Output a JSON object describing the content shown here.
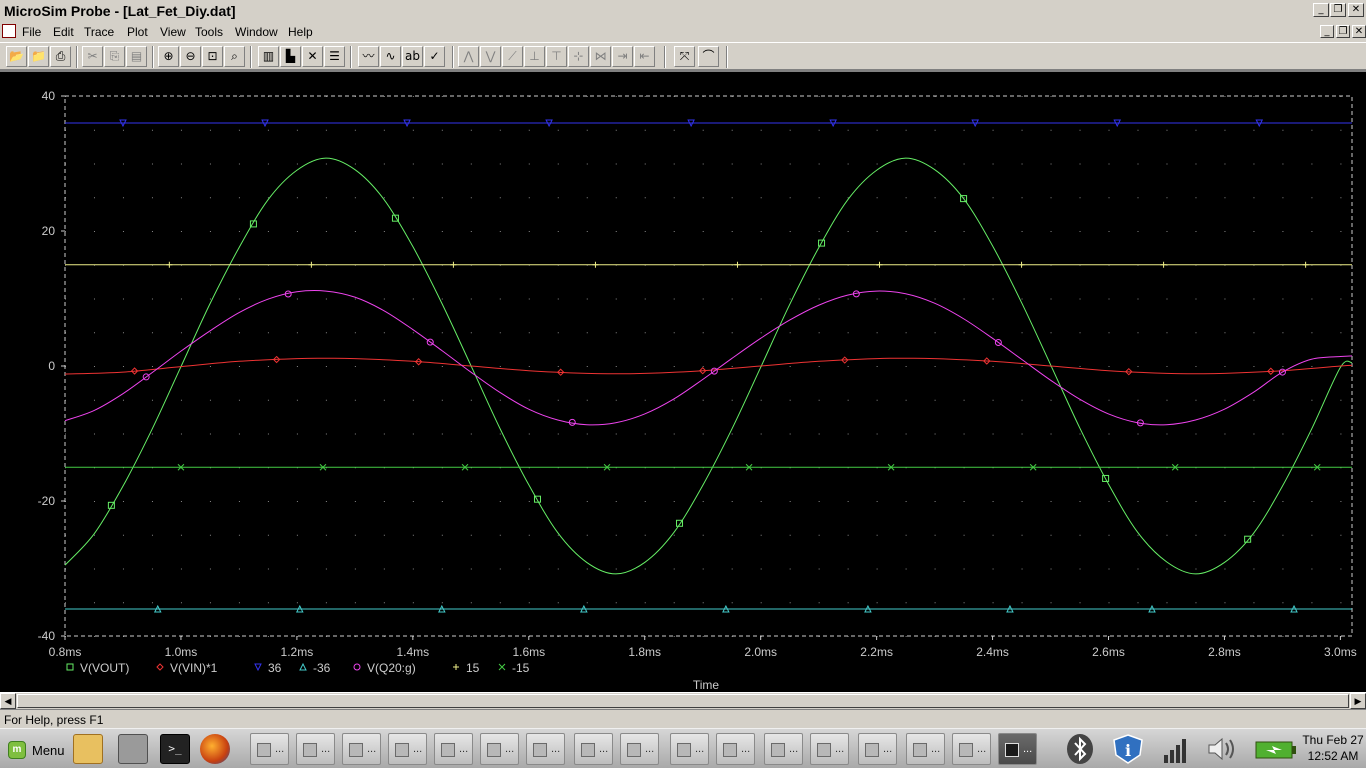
{
  "window": {
    "title": "MicroSim Probe - [Lat_Fet_Diy.dat]"
  },
  "menu": [
    "File",
    "Edit",
    "Trace",
    "Plot",
    "View",
    "Tools",
    "Window",
    "Help"
  ],
  "status": "For Help, press F1",
  "taskbar": {
    "menu_label": "Menu",
    "task_label": "...",
    "clock_day": "Thu Feb 27",
    "clock_time": "12:52 AM"
  },
  "colors": {
    "vout": "#66ee66",
    "vin": "#ee3333",
    "p36": "#3333ee",
    "m36": "#44cccc",
    "q20": "#ee44ee",
    "p15": "#eeee88",
    "m15": "#44cc44",
    "axis": "#cccccc"
  },
  "chart_data": {
    "type": "line",
    "xlabel": "Time",
    "ylabel": "",
    "xlim": [
      0.0008,
      0.00302
    ],
    "ylim": [
      -40,
      40
    ],
    "grid": true,
    "legend_position": "bottom-left",
    "x_ticks": [
      0.0008,
      0.001,
      0.0012,
      0.0014,
      0.0016,
      0.0018,
      0.002,
      0.0022,
      0.0024,
      0.0026,
      0.0028,
      0.003
    ],
    "x_tick_labels": [
      "0.8ms",
      "1.0ms",
      "1.2ms",
      "1.4ms",
      "1.6ms",
      "1.8ms",
      "2.0ms",
      "2.2ms",
      "2.4ms",
      "2.6ms",
      "2.8ms",
      "3.0ms"
    ],
    "y_ticks": [
      40,
      20,
      0,
      -20,
      -40
    ],
    "y_tick_labels": [
      "40",
      "20",
      "0",
      "-20",
      "-40"
    ],
    "series": [
      {
        "name": "V(VOUT)",
        "marker": "square",
        "color": "#66ee66",
        "x": [
          0.0008,
          0.00085,
          0.0009,
          0.00095,
          0.001,
          0.00105,
          0.0011,
          0.00115,
          0.0012,
          0.00125,
          0.0013,
          0.00135,
          0.0014,
          0.00145,
          0.0015,
          0.00155,
          0.0016,
          0.00165,
          0.0017,
          0.00175,
          0.0018,
          0.00185,
          0.0019,
          0.00195,
          0.002,
          0.00205,
          0.0021,
          0.00215,
          0.0022,
          0.00225,
          0.0023,
          0.00235,
          0.0024,
          0.00245,
          0.0025,
          0.00255,
          0.0026,
          0.00265,
          0.0027,
          0.00275,
          0.0028,
          0.00285,
          0.0029,
          0.00295,
          0.003,
          0.00302
        ],
        "y": [
          -29.5,
          -24.9,
          -17.8,
          -9.4,
          -0.1,
          9.2,
          17.5,
          24.6,
          29.0,
          30.8,
          29.1,
          24.7,
          17.7,
          9.3,
          0.1,
          -9.2,
          -17.6,
          -24.7,
          -29.1,
          -30.8,
          -29.1,
          -24.7,
          -17.7,
          -9.4,
          -0.2,
          9.1,
          17.5,
          24.6,
          29.0,
          30.8,
          29.1,
          24.8,
          17.8,
          9.4,
          0.2,
          -9.1,
          -17.5,
          -24.6,
          -29.0,
          -30.8,
          -29.1,
          -24.8,
          -17.8,
          -9.4,
          -0.2,
          0.5
        ]
      },
      {
        "name": "V(VIN)*1",
        "marker": "diamond",
        "color": "#ee3333",
        "x": [
          0.0008,
          0.0009,
          0.001,
          0.0011,
          0.0012,
          0.00125,
          0.0013,
          0.0014,
          0.0015,
          0.0016,
          0.0017,
          0.00175,
          0.0018,
          0.0019,
          0.002,
          0.0021,
          0.0022,
          0.00225,
          0.0023,
          0.0024,
          0.0025,
          0.0026,
          0.0027,
          0.00275,
          0.0028,
          0.0029,
          0.003,
          0.00302
        ],
        "y": [
          -1.2,
          -0.9,
          -0.1,
          0.7,
          1.1,
          1.15,
          1.1,
          0.7,
          0.0,
          -0.7,
          -1.1,
          -1.15,
          -1.1,
          -0.7,
          0.0,
          0.7,
          1.1,
          1.15,
          1.1,
          0.7,
          0.0,
          -0.7,
          -1.1,
          -1.15,
          -1.1,
          -0.7,
          0.0,
          0.1
        ]
      },
      {
        "name": "36",
        "marker": "triangle-down",
        "color": "#3333ee",
        "x": [
          0.0008,
          0.00302
        ],
        "y": [
          36,
          36
        ]
      },
      {
        "name": "-36",
        "marker": "triangle-up",
        "color": "#44cccc",
        "x": [
          0.0008,
          0.00302
        ],
        "y": [
          -36,
          -36
        ]
      },
      {
        "name": "V(Q20:g)",
        "marker": "circle",
        "color": "#ee44ee",
        "x": [
          0.0008,
          0.00085,
          0.0009,
          0.00095,
          0.001,
          0.00105,
          0.0011,
          0.00115,
          0.0012,
          0.00125,
          0.0013,
          0.00135,
          0.0014,
          0.00145,
          0.0015,
          0.00155,
          0.0016,
          0.00165,
          0.0017,
          0.00175,
          0.0018,
          0.00185,
          0.0019,
          0.00195,
          0.002,
          0.00205,
          0.0021,
          0.00215,
          0.0022,
          0.00225,
          0.0023,
          0.00235,
          0.0024,
          0.00245,
          0.0025,
          0.00255,
          0.0026,
          0.00265,
          0.0027,
          0.00275,
          0.0028,
          0.00285,
          0.0029,
          0.00295,
          0.003,
          0.00302
        ],
        "y": [
          -8.1,
          -6.6,
          -4.1,
          -1.0,
          2.2,
          5.2,
          7.9,
          9.9,
          11.0,
          11.1,
          10.2,
          8.2,
          5.4,
          2.3,
          -0.9,
          -3.9,
          -6.4,
          -8.0,
          -8.7,
          -8.4,
          -7.1,
          -4.9,
          -2.0,
          1.1,
          4.1,
          6.8,
          9.0,
          10.5,
          11.1,
          10.7,
          9.3,
          7.0,
          4.1,
          1.0,
          -2.1,
          -4.9,
          -7.1,
          -8.4,
          -8.7,
          -8.0,
          -6.4,
          -3.9,
          -0.9,
          1.0,
          1.4,
          1.5
        ]
      },
      {
        "name": "15",
        "marker": "plus",
        "color": "#eeee88",
        "x": [
          0.0008,
          0.00302
        ],
        "y": [
          15,
          15
        ]
      },
      {
        "name": "-15",
        "marker": "cross",
        "color": "#44cc44",
        "x": [
          0.0008,
          0.00302
        ],
        "y": [
          -15,
          -15
        ]
      }
    ]
  }
}
